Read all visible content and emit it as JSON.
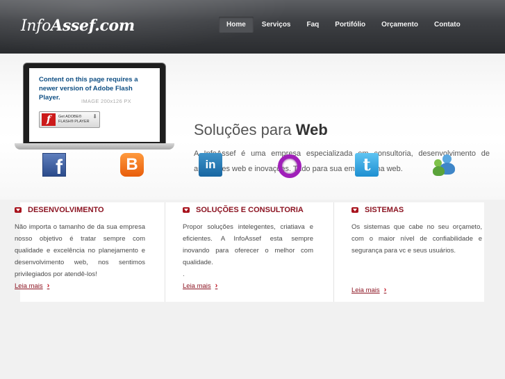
{
  "header": {
    "logo_prefix": "Info",
    "logo_bold": "Assef.com",
    "nav": [
      "Home",
      "Serviços",
      "Faq",
      "Portifólio",
      "Orçamento",
      "Contato"
    ],
    "active_nav": "Home"
  },
  "flash": {
    "message": "Content on this page requires a newer version of Adobe Flash Player.",
    "placeholder": "IMAGE 200x126 PX",
    "badge_line1": "Get ADOBE®",
    "badge_line2": "FLASH® PLAYER"
  },
  "hero": {
    "title_prefix": "Soluções para ",
    "title_bold": "Web",
    "text": "A InfoAssef é uma empresa especializada em consultoria, desenvolvimento de aplicações web e inovações. Tudo para sua empresa na web."
  },
  "social": [
    {
      "name": "facebook-icon",
      "glyph": "f"
    },
    {
      "name": "blogger-icon",
      "glyph": "B"
    },
    {
      "name": "linkedin-icon",
      "glyph": "in"
    },
    {
      "name": "orkut-icon",
      "glyph": ""
    },
    {
      "name": "twitter-icon",
      "glyph": "t"
    },
    {
      "name": "users-icon",
      "glyph": ""
    }
  ],
  "columns": [
    {
      "title": "DESENVOLVIMENTO",
      "text": "Não importa o tamanho de da sua empresa nosso objetivo é tratar sempre com qualidade e excelência no planejamento e desenvolvimento web, nos sentimos privilegiados por atendê-los!",
      "link": "Leia mais"
    },
    {
      "title": "SOLUÇÕES E CONSULTORIA",
      "text": "Propor soluções intelegentes, criatiava e eficientes. A InfoAssef esta sempre inovando para oferecer o melhor com qualidade.",
      "extra": ".",
      "link": "Leia mais"
    },
    {
      "title": "SISTEMAS",
      "text": "Os sistemas que cabe no seu orçameto, com o maior nível de confiabilidade e segurança para vc e seus usuários.",
      "link": "Leia mais"
    }
  ],
  "colors": {
    "header_dark": "#2a2c2f",
    "accent_red": "#8c1422",
    "flash_text_blue": "#0e4e83"
  }
}
